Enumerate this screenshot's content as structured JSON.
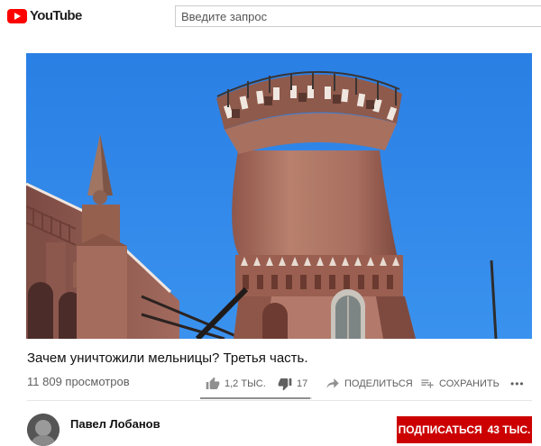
{
  "header": {
    "logo_text": "YouTube",
    "search_placeholder": "Введите запрос"
  },
  "video": {
    "title": "Зачем уничтожили мельницы? Третья часть.",
    "views": "11 809 просмотров",
    "likes": "1,2 ТЫС.",
    "dislikes": "17",
    "share_label": "ПОДЕЛИТЬСЯ",
    "save_label": "СОХРАНИТЬ",
    "more_label": "•••",
    "like_ratio": 0.986
  },
  "channel": {
    "name": "Павел Лобанов",
    "subscribe_label": "ПОДПИСАТЬСЯ",
    "subscriber_count": "43 ТЫС."
  },
  "icons": {
    "like": "thumbs-up-icon",
    "dislike": "thumbs-down-icon",
    "share": "share-arrow-icon",
    "save": "playlist-add-icon",
    "more": "more-dots-icon"
  },
  "colors": {
    "brand_red": "#ff0000",
    "subscribe_red": "#cc0000",
    "sky_blue": "#2f84e6",
    "tower_brick": "#b07462"
  }
}
